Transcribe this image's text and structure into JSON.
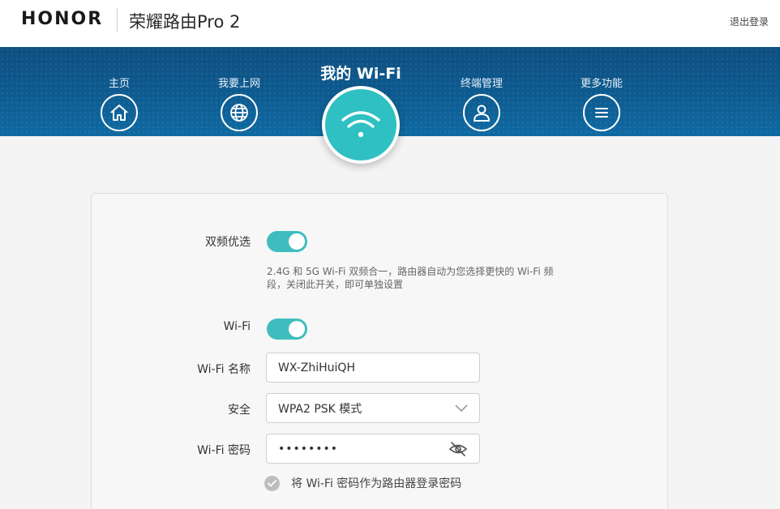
{
  "header": {
    "brand": "HONOR",
    "product": "荣耀路由Pro 2",
    "logout": "退出登录"
  },
  "nav": {
    "items": [
      {
        "label": "主页",
        "icon": "home-icon"
      },
      {
        "label": "我要上网",
        "icon": "globe-icon"
      },
      {
        "label": "我的 Wi-Fi",
        "icon": "wifi-icon",
        "active": true
      },
      {
        "label": "终端管理",
        "icon": "user-icon"
      },
      {
        "label": "更多功能",
        "icon": "menu-icon"
      }
    ]
  },
  "settings": {
    "dual_band": {
      "label": "双频优选",
      "enabled": true,
      "hint": "2.4G 和 5G Wi-Fi 双频合一，路由器自动为您选择更快的 Wi-Fi 频段，关闭此开关，即可单独设置"
    },
    "wifi": {
      "label": "Wi-Fi",
      "enabled": true
    },
    "ssid": {
      "label": "Wi-Fi 名称",
      "value": "WX-ZhiHuiQH"
    },
    "security": {
      "label": "安全",
      "value": "WPA2 PSK 模式"
    },
    "password": {
      "label": "Wi-Fi 密码",
      "value": "••••••••"
    },
    "use_as_admin": {
      "label": "将 Wi-Fi 密码作为路由器登录密码",
      "checked": false
    }
  },
  "colors": {
    "accent": "#3fbdbe",
    "nav_bg": "#0d5a8f",
    "active_circle": "#2ec0c2"
  }
}
